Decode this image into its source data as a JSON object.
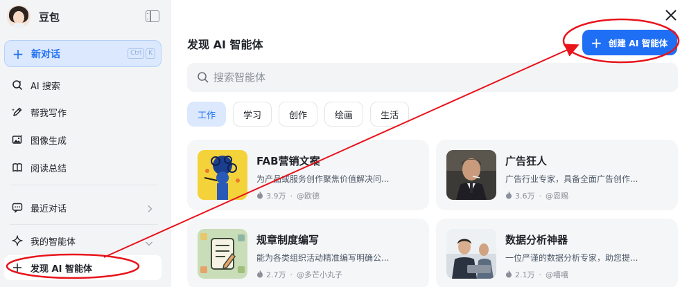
{
  "sidebar": {
    "app_name": "豆包",
    "new_chat": "新对话",
    "shortcut": [
      "Ctrl",
      "K"
    ],
    "items": [
      {
        "label": "AI 搜索",
        "icon": "search-spark-icon"
      },
      {
        "label": "帮我写作",
        "icon": "pen-icon"
      },
      {
        "label": "图像生成",
        "icon": "image-icon"
      },
      {
        "label": "阅读总结",
        "icon": "book-icon"
      }
    ],
    "recent": "最近对话",
    "my_agents": "我的智能体",
    "discover": "发现 AI 智能体"
  },
  "main": {
    "title": "发现 AI 智能体",
    "create_button": "创建 AI 智能体",
    "search_placeholder": "搜索智能体",
    "tabs": [
      "工作",
      "学习",
      "创作",
      "绘画",
      "生活"
    ],
    "active_tab": "工作",
    "cards": [
      {
        "name": "FAB营销文案",
        "desc": "为产品或服务创作聚焦价值解决问...",
        "count": "3.9万",
        "author": "@欧德"
      },
      {
        "name": "广告狂人",
        "desc": "广告行业专家，具备全面广告创作...",
        "count": "3.6万",
        "author": "@恩赐"
      },
      {
        "name": "规章制度编写",
        "desc": "能为各类组织活动精准编写明确公...",
        "count": "2.7万",
        "author": "@多芒小丸子"
      },
      {
        "name": "数据分析神器",
        "desc": "一位严谨的数据分析专家，助您提...",
        "count": "2.1万",
        "author": "@嘻嘻"
      }
    ]
  },
  "colors": {
    "accent": "#1f6ff5",
    "annotation": "#e8131b",
    "sidebar_bg": "#f3f4f6"
  }
}
